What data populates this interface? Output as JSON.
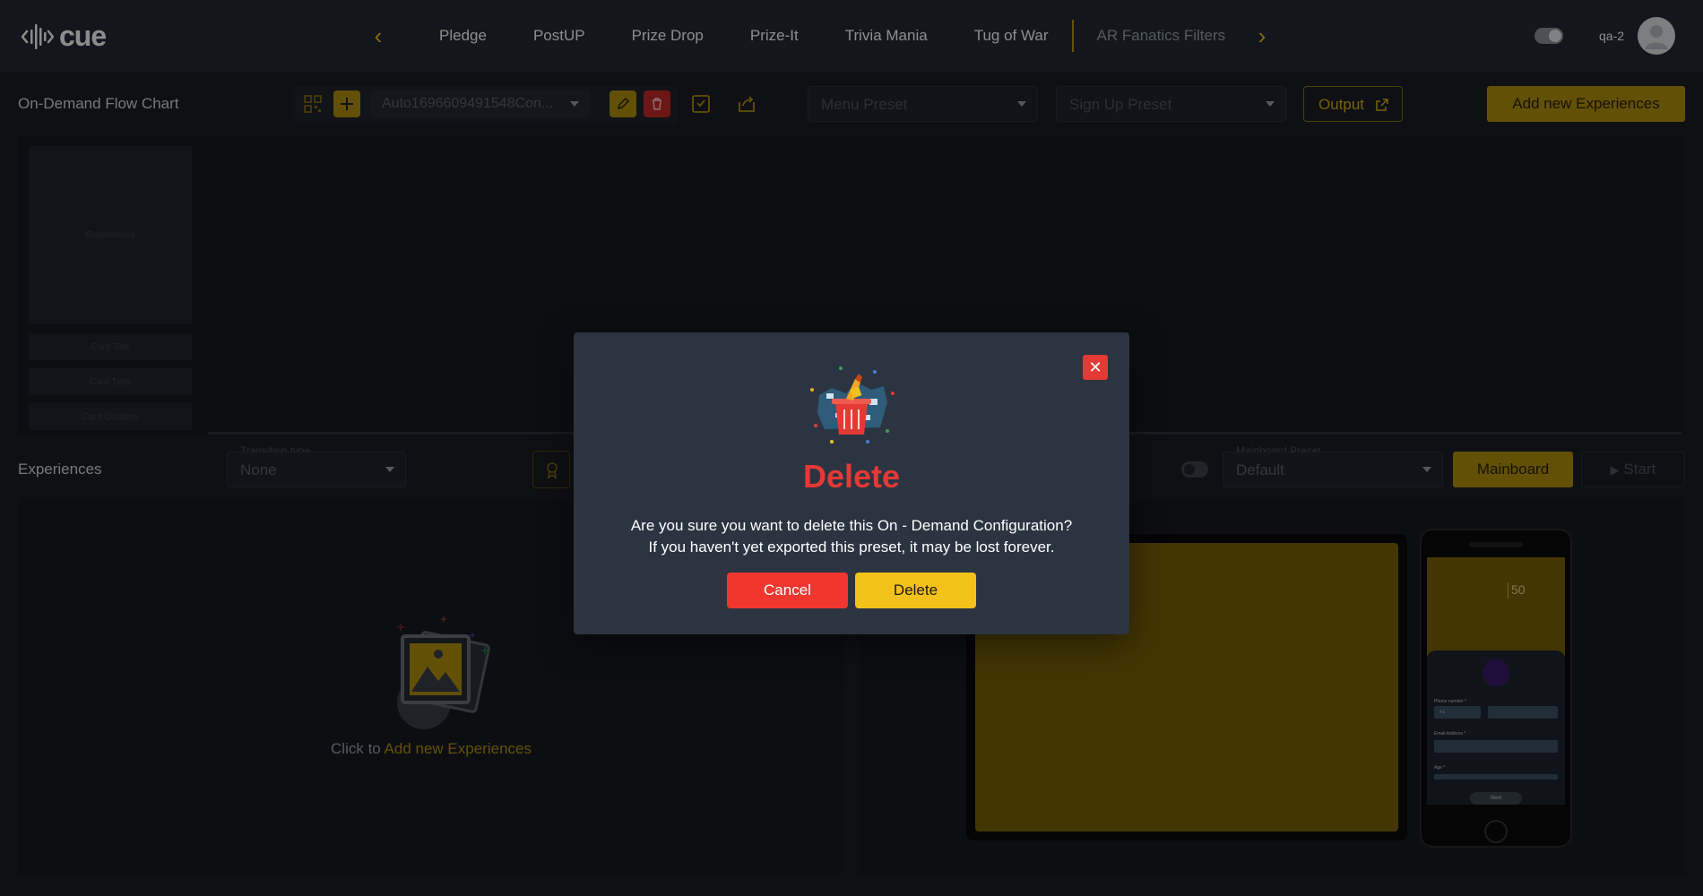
{
  "app": {
    "logo_text": "cue",
    "user_name": "qa-2"
  },
  "nav": {
    "items": [
      {
        "label": "Pledge"
      },
      {
        "label": "PostUP"
      },
      {
        "label": "Prize Drop"
      },
      {
        "label": "Prize-It"
      },
      {
        "label": "Trivia Mania"
      },
      {
        "label": "Tug of War"
      },
      {
        "label": "AR Fanatics Filters"
      }
    ],
    "prev_icon": "chevron-left-icon",
    "next_icon": "chevron-right-icon"
  },
  "toolbar": {
    "title": "On-Demand Flow Chart",
    "preset_name": "Auto1696609491548Con...",
    "menu_preset_placeholder": "Menu Preset",
    "signup_preset_placeholder": "Sign Up Preset",
    "output_label": "Output",
    "add_experiences_label": "Add new Experiences"
  },
  "flow_chart": {
    "card_preview_label": "Experiences",
    "card_fields": [
      "Card Title",
      "Card Type",
      "Card Duration"
    ]
  },
  "experiences": {
    "title": "Experiences",
    "transition_label": "Transition type",
    "transition_value": "None",
    "mainboard_preset_label": "Mainboard Preset",
    "mainboard_preset_value": "Default",
    "mainboard_label": "Mainboard",
    "start_label": "Start",
    "empty_prefix": "Click to",
    "empty_link": "Add new Experiences"
  },
  "phone_preview": {
    "score": "50",
    "phone_label": "Phone number *",
    "country_code": "+1",
    "email_label": "Email Address *",
    "age_label": "Age *",
    "next_label": "Next"
  },
  "modal": {
    "title": "Delete",
    "line1": "Are you sure you want to delete this On - Demand Configuration?",
    "line2": "If you haven't yet exported this preset, it may be lost forever.",
    "cancel_label": "Cancel",
    "delete_label": "Delete"
  },
  "colors": {
    "accent": "#f2c21b",
    "danger": "#e53935",
    "background": "#1a1e26",
    "topbar": "#232a36",
    "modal": "#2c3442"
  }
}
